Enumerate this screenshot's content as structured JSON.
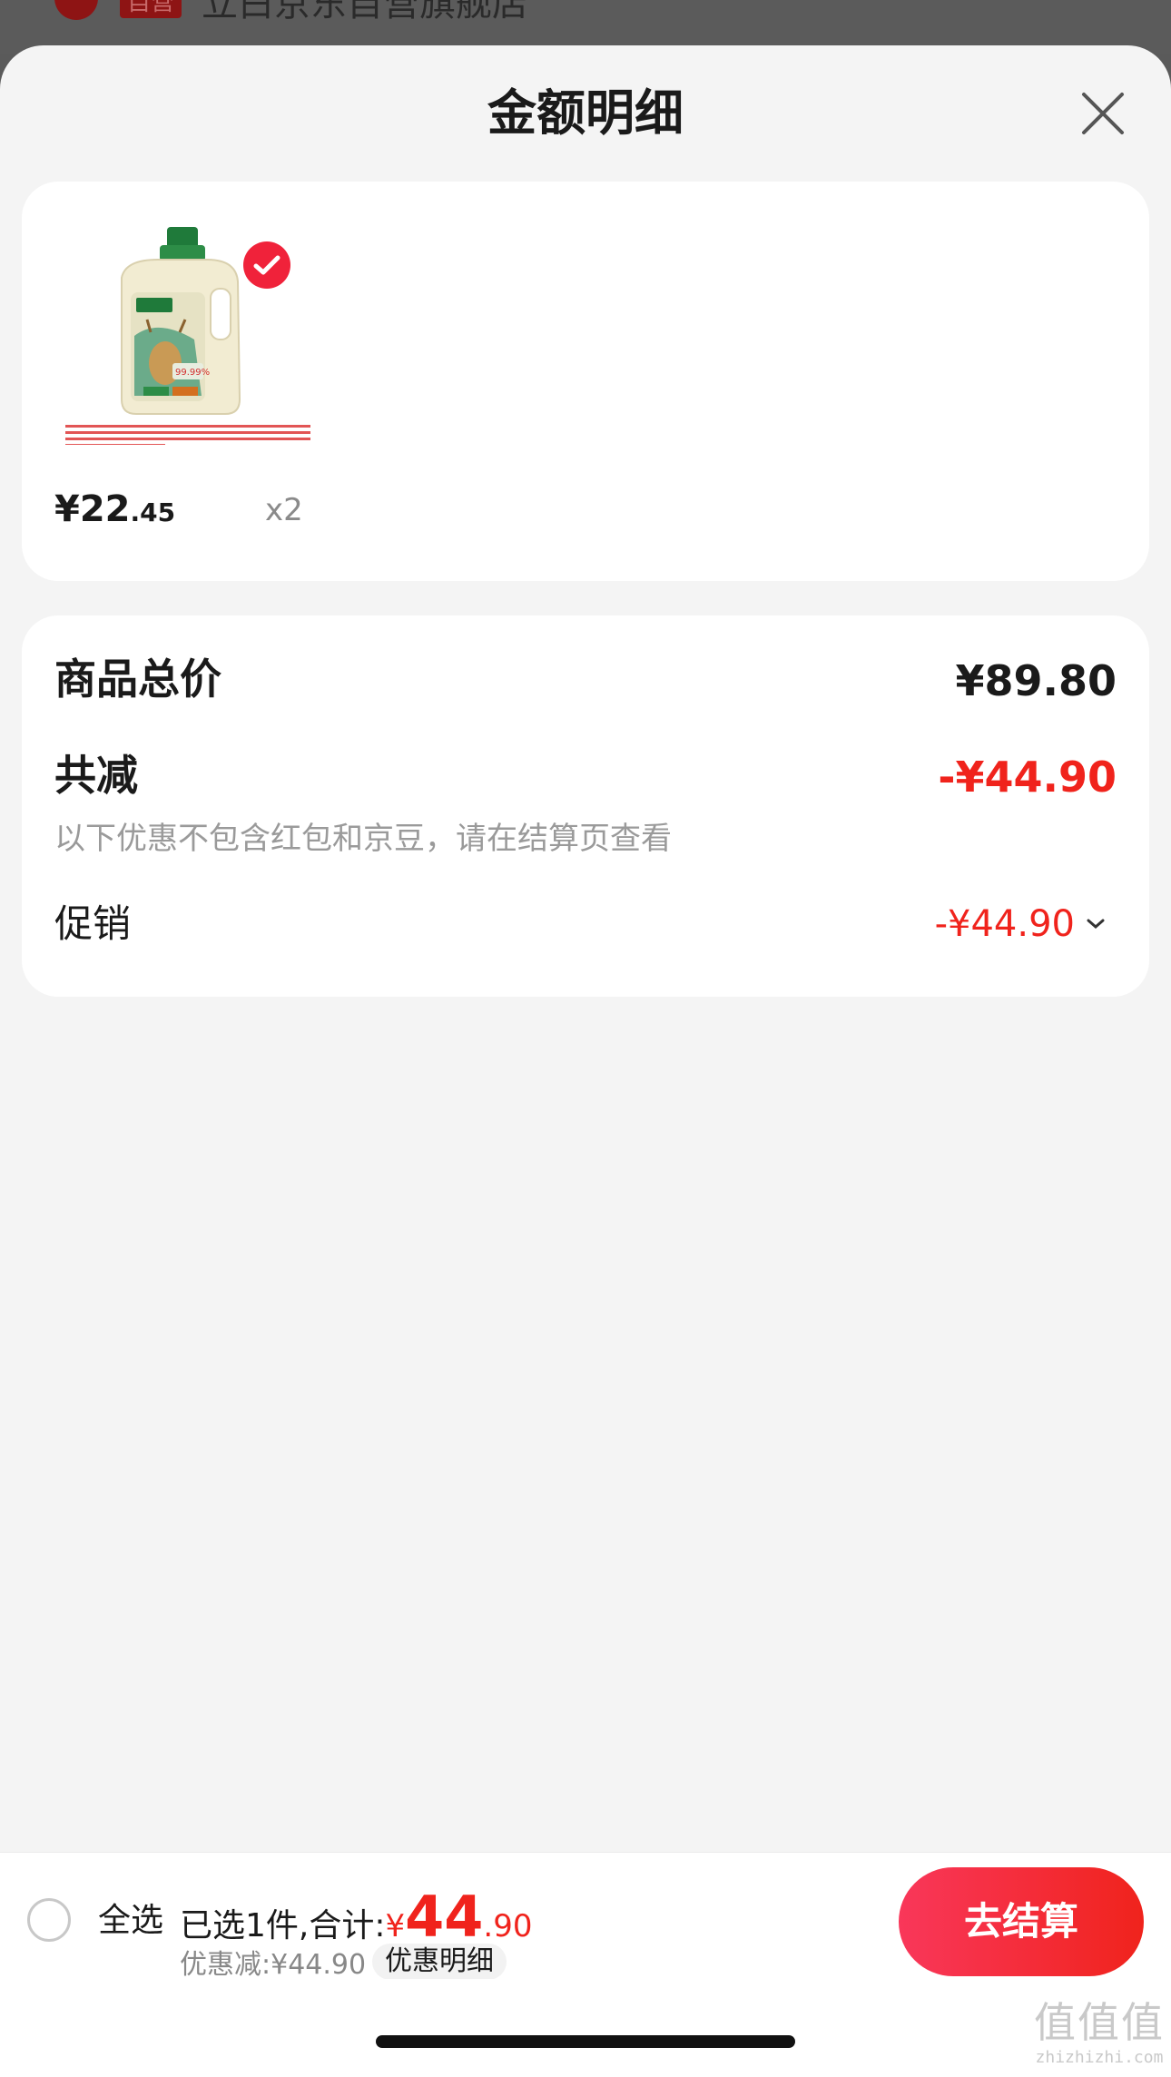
{
  "background": {
    "tag": "自营",
    "store_name": "立白京东自营旗舰店"
  },
  "sheet": {
    "title": "金额明细",
    "close_icon": "close-icon"
  },
  "product": {
    "price_main": "¥22",
    "price_decimal": ".45",
    "quantity": "x2",
    "selected": true,
    "image_alt": "laundry-detergent-bottle"
  },
  "summary": {
    "total_label": "商品总价",
    "total_value": "¥89.80",
    "reduce_label": "共减",
    "reduce_value": "-¥44.90",
    "note": "以下优惠不包含红包和京豆，请在结算页查看",
    "promo_label": "促销",
    "promo_value": "-¥44.90"
  },
  "bottom_bar": {
    "select_all": "全选",
    "selected_prefix": "已选1件,合计:",
    "sum_symbol": "¥",
    "sum_int": "44",
    "sum_decimal": ".90",
    "saving": "优惠减:¥44.90",
    "detail_button": "优惠明细",
    "checkout_button": "去结算"
  },
  "watermark": {
    "logo": "值值值",
    "url": "zhizhizhi.com"
  },
  "colors": {
    "accent_red": "#f0231c",
    "checkout_gradient_start": "#f9375a",
    "sheet_bg": "#f4f4f4"
  }
}
